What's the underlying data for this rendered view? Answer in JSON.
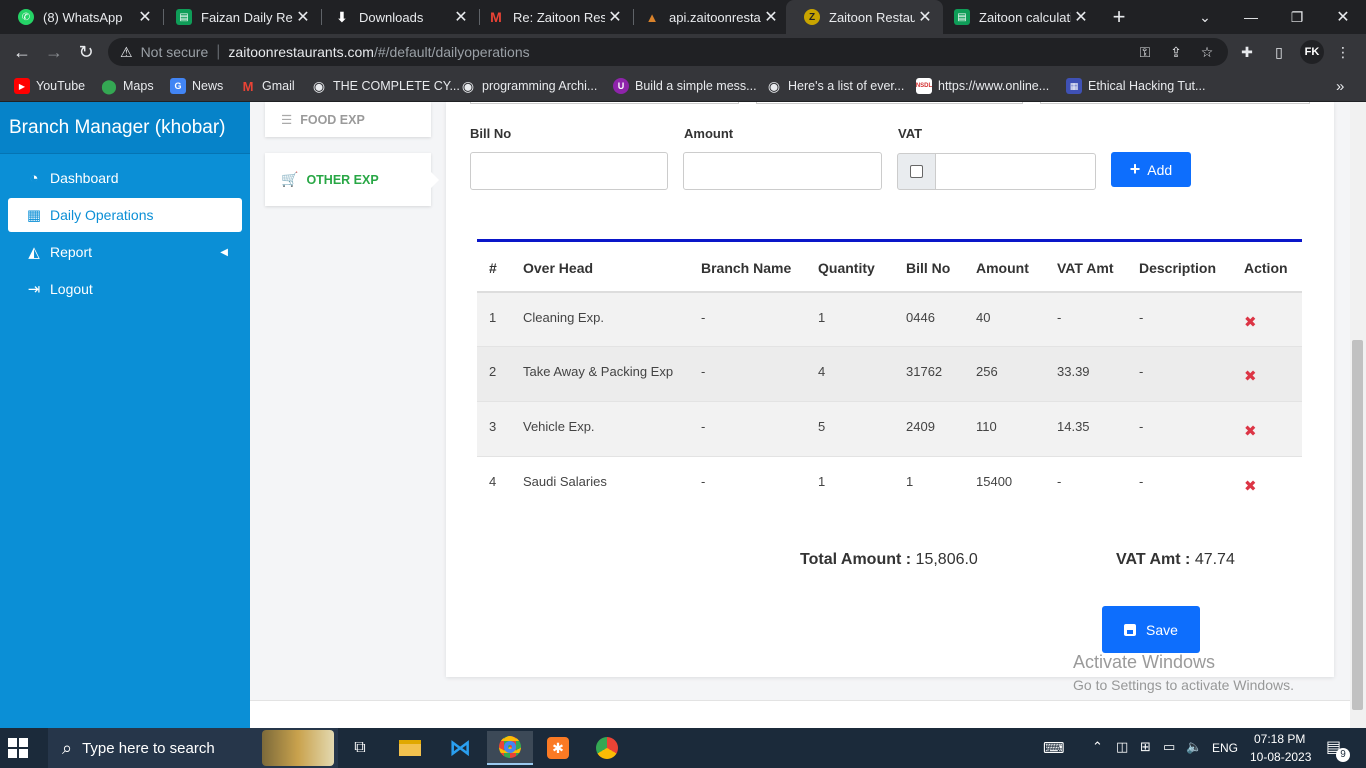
{
  "browser": {
    "tabs": [
      {
        "title": "(8) WhatsApp",
        "icon": "whatsapp-icon",
        "color": "#25d366"
      },
      {
        "title": "Faizan Daily Repo",
        "icon": "sheets-icon",
        "color": "#0f9d58"
      },
      {
        "title": "Downloads",
        "icon": "download-icon",
        "color": "#202124"
      },
      {
        "title": "Re: Zaitoon Resta",
        "icon": "gmail-icon",
        "color": "#ea4335"
      },
      {
        "title": "api.zaitoonrestau",
        "icon": "api-icon",
        "color": "#b5651d"
      },
      {
        "title": "Zaitoon Restaura",
        "icon": "zaitoon-icon",
        "color": "#c8a400"
      },
      {
        "title": "Zaitoon calculatio",
        "icon": "sheets-icon",
        "color": "#0f9d58"
      }
    ],
    "address": {
      "security": "Not secure",
      "host": "zaitoonrestaurants.com",
      "path": "/#/default/dailyoperations"
    },
    "profile_initials": "FK",
    "bookmarks": [
      {
        "label": "YouTube",
        "icon": "youtube-icon",
        "color": "#ff0000"
      },
      {
        "label": "Maps",
        "icon": "maps-icon",
        "color": "#34a853"
      },
      {
        "label": "News",
        "icon": "news-icon",
        "color": "#4285f4"
      },
      {
        "label": "Gmail",
        "icon": "gmail-icon",
        "color": "#ea4335"
      },
      {
        "label": "THE COMPLETE CY...",
        "icon": "globe-icon",
        "color": "#9aa0a6"
      },
      {
        "label": "programming Archi...",
        "icon": "globe-icon",
        "color": "#9aa0a6"
      },
      {
        "label": "Build a simple mess...",
        "icon": "bookmark-icon",
        "color": "#8e24aa"
      },
      {
        "label": "Here's a list of ever...",
        "icon": "globe-icon",
        "color": "#9aa0a6"
      },
      {
        "label": "https://www.online...",
        "icon": "nsdl-icon",
        "color": "#d32f2f"
      },
      {
        "label": "Ethical Hacking Tut...",
        "icon": "site-icon",
        "color": "#3f51b5"
      }
    ]
  },
  "sidebar": {
    "brand": "Branch Manager (khobar)",
    "items": [
      {
        "label": "Dashboard",
        "icon": "dashboard-icon",
        "glyph": "◔"
      },
      {
        "label": "Daily Operations",
        "icon": "calendar-icon",
        "glyph": "▦"
      },
      {
        "label": "Report",
        "icon": "chart-icon",
        "glyph": "◭"
      },
      {
        "label": "Logout",
        "icon": "logout-icon",
        "glyph": "⇥"
      }
    ]
  },
  "expense_tabs": {
    "food": "FOOD EXP",
    "other": "OTHER EXP"
  },
  "form": {
    "bill_no_label": "Bill No",
    "amount_label": "Amount",
    "vat_label": "VAT",
    "bill_no_value": "",
    "amount_value": "",
    "vat_value": "",
    "add_label": "Add"
  },
  "table": {
    "columns": [
      "#",
      "Over Head",
      "Branch Name",
      "Quantity",
      "Bill No",
      "Amount",
      "VAT Amt",
      "Description",
      "Action"
    ],
    "rows": [
      {
        "n": "1",
        "overhead": "Cleaning Exp.",
        "branch": "-",
        "qty": "1",
        "bill": "0446",
        "amount": "40",
        "vat": "-",
        "desc": "-"
      },
      {
        "n": "2",
        "overhead": "Take Away & Packing Exp",
        "branch": "-",
        "qty": "4",
        "bill": "31762",
        "amount": "256",
        "vat": "33.39",
        "desc": "-"
      },
      {
        "n": "3",
        "overhead": "Vehicle Exp.",
        "branch": "-",
        "qty": "5",
        "bill": "2409",
        "amount": "110",
        "vat": "14.35",
        "desc": "-"
      },
      {
        "n": "4",
        "overhead": "Saudi Salaries",
        "branch": "-",
        "qty": "1",
        "bill": "1",
        "amount": "15400",
        "vat": "-",
        "desc": "-"
      }
    ],
    "delete_glyph": "✖"
  },
  "totals": {
    "total_label": "Total Amount :",
    "total_value": "15,806.0",
    "vat_label": "VAT Amt :",
    "vat_value": "47.74"
  },
  "save_label": "Save",
  "watermark": {
    "line1": "Activate Windows",
    "line2": "Go to Settings to activate Windows."
  },
  "taskbar": {
    "search_placeholder": "Type here to search",
    "language": "ENG",
    "time": "07:18 PM",
    "date": "10-08-2023",
    "notifications": "9"
  },
  "colors": {
    "sidebar": "#0b8fd6",
    "primary_button": "#0d6efd",
    "table_accent": "#0a16c9",
    "other_exp": "#28a745",
    "delete": "#dc3545"
  }
}
